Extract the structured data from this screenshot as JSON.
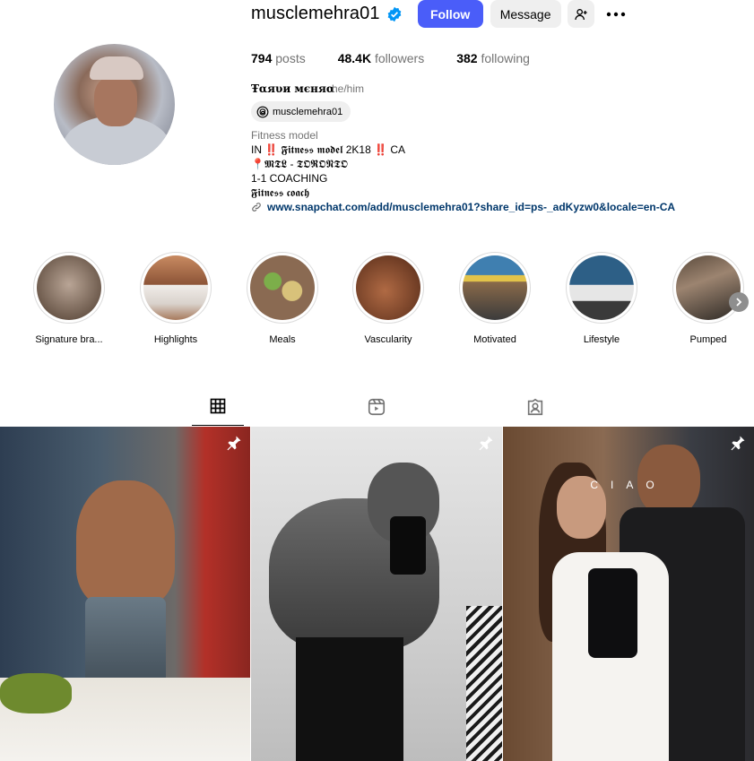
{
  "profile": {
    "username": "musclemehra01",
    "follow_label": "Follow",
    "message_label": "Message",
    "posts_count": "794",
    "posts_label": "posts",
    "followers_count": "48.4K",
    "followers_label": "followers",
    "following_count": "382",
    "following_label": "following",
    "full_name": "Ŧαяυи мєняα",
    "pronouns": "he/him",
    "threads_handle": "musclemehra01",
    "category": "Fitness model",
    "bio_lines": [
      "IN ‼️ 𝕱𝖎𝖙𝖓𝖊𝖘𝖘 𝖒𝖔𝖉𝖊𝖑 2K18 ‼️ CA",
      "📍𝕸𝕿𝕷 - 𝕿𝕺𝕽𝕺𝕹𝕿𝕺",
      "1-1 COACHING",
      "𝕱𝖎𝖙𝖓𝖊𝖘𝖘 𝖈𝖔𝖆𝖈𝖍"
    ],
    "link": "www.snapchat.com/add/musclemehra01?share_id=ps-_adKyzw0&locale=en-CA"
  },
  "highlights": [
    {
      "label": "Signature bra...",
      "icon": "signature-highlight"
    },
    {
      "label": "Highlights",
      "icon": "highlights-highlight"
    },
    {
      "label": "Meals",
      "icon": "meals-highlight"
    },
    {
      "label": "Vascularity",
      "icon": "vascularity-highlight"
    },
    {
      "label": "Motivated",
      "icon": "motivated-highlight"
    },
    {
      "label": "Lifestyle",
      "icon": "lifestyle-highlight"
    },
    {
      "label": "Pumped",
      "icon": "pumped-highlight"
    }
  ],
  "tabs": [
    {
      "name": "posts",
      "icon": "grid-icon",
      "active": true
    },
    {
      "name": "reels",
      "icon": "reels-icon",
      "active": false
    },
    {
      "name": "tagged",
      "icon": "tagged-icon",
      "active": false
    }
  ],
  "posts": [
    {
      "pinned": true,
      "overlay_text": ""
    },
    {
      "pinned": true,
      "overlay_text": ""
    },
    {
      "pinned": true,
      "overlay_text": "CIAO"
    }
  ],
  "colors": {
    "accent": "#4a5df9",
    "link": "#00376b",
    "muted": "#737373",
    "verified": "#0095f6"
  }
}
